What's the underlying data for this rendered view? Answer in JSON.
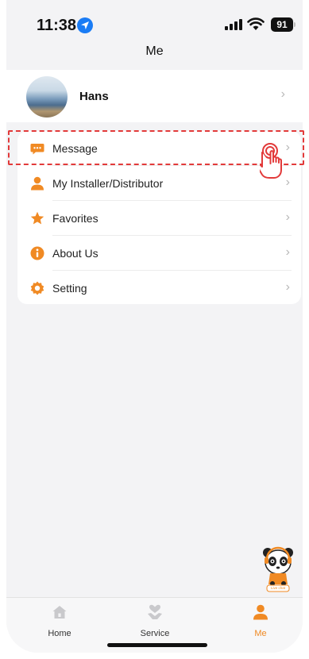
{
  "status_bar": {
    "time": "11:38",
    "battery": "91"
  },
  "page": {
    "title": "Me"
  },
  "profile": {
    "name": "Hans"
  },
  "menu": {
    "items": [
      {
        "label": "Message",
        "icon": "message-icon"
      },
      {
        "label": "My Installer/Distributor",
        "icon": "person-icon"
      },
      {
        "label": "Favorites",
        "icon": "star-icon"
      },
      {
        "label": "About Us",
        "icon": "info-icon"
      },
      {
        "label": "Setting",
        "icon": "gear-icon"
      }
    ]
  },
  "tabbar": {
    "tabs": [
      {
        "label": "Home",
        "icon": "home-icon"
      },
      {
        "label": "Service",
        "icon": "heart-hand-icon"
      },
      {
        "label": "Me",
        "icon": "user-icon",
        "active": true
      }
    ]
  },
  "mascot": {
    "badge": "Live chat"
  },
  "colors": {
    "accent": "#f08a24",
    "highlight": "#e23a3a"
  }
}
